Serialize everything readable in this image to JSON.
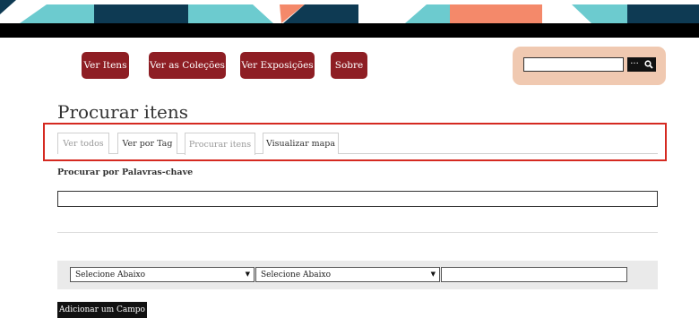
{
  "nav": {
    "items": [
      {
        "label": "Ver Itens"
      },
      {
        "label": "Ver as Coleções"
      },
      {
        "label": "Ver Exposições"
      },
      {
        "label": "Sobre"
      }
    ]
  },
  "search": {
    "placeholder": "",
    "options_label": "···",
    "submit_icon": "search-icon"
  },
  "page": {
    "title": "Procurar itens",
    "tabs": [
      {
        "label": "Ver todos",
        "state": "muted"
      },
      {
        "label": "Ver por Tag",
        "state": "normal"
      },
      {
        "label": "Procurar itens",
        "state": "active"
      },
      {
        "label": "Visualizar mapa",
        "state": "normal"
      }
    ]
  },
  "form": {
    "keyword_label": "Procurar por Palavras-chave",
    "keyword_value": "",
    "field_select_1": "Selecione Abaixo",
    "field_select_2": "Selecione Abaixo",
    "field_value": "",
    "add_field_label": "Adicionar um Campo"
  },
  "colors": {
    "nav_button": "#8e1e24",
    "search_panel": "#f0c9b1",
    "highlight": "#d52a21",
    "banner_teal": "#6ccbcf",
    "banner_navy": "#0e3a53",
    "banner_salmon": "#f4896a"
  }
}
